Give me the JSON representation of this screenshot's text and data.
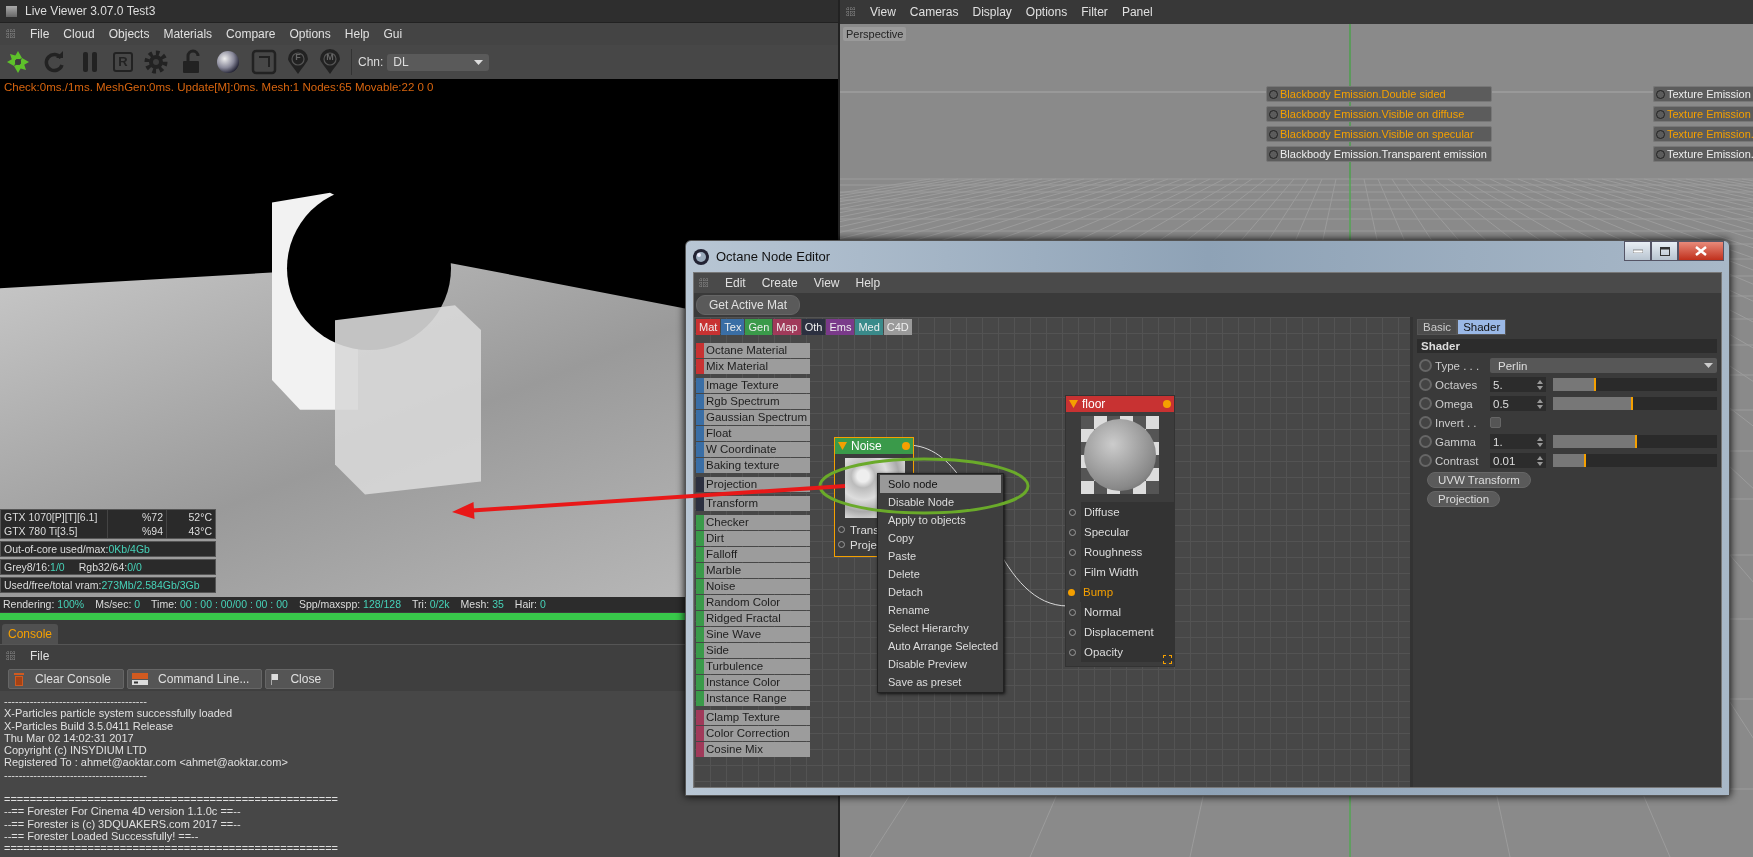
{
  "live_viewer": {
    "title": "Live Viewer 3.07.0 Test3",
    "menu": [
      "File",
      "Cloud",
      "Objects",
      "Materials",
      "Compare",
      "Options",
      "Help",
      "Gui"
    ],
    "toolbar": [
      {
        "kind": "logo"
      },
      {
        "kind": "refresh"
      },
      {
        "kind": "pause"
      },
      {
        "kind": "letter",
        "label": "R"
      },
      {
        "kind": "gear"
      },
      {
        "kind": "lock"
      },
      {
        "kind": "sphere"
      },
      {
        "kind": "frame"
      },
      {
        "kind": "pin",
        "label": "F"
      },
      {
        "kind": "pin",
        "label": "M"
      }
    ],
    "channel": {
      "label": "Chn:",
      "value": "DL"
    },
    "stats_line": "Check:0ms./1ms. MeshGen:0ms. Update[M]:0ms. Mesh:1 Nodes:65 Movable:22  0 0",
    "gpus": [
      {
        "name": "GTX 1070[P][T][6.1]",
        "load": "%72",
        "temp": "52°C"
      },
      {
        "name": "GTX 780 Ti[3.5]",
        "load": "%94",
        "temp": "43°C"
      }
    ],
    "memory": [
      [
        {
          "label": "Out-of-core used/max:",
          "value": "0Kb/4Gb"
        }
      ],
      [
        {
          "label": "Grey8/16:",
          "value": "1/0"
        },
        {
          "label": "Rgb32/64:",
          "value": "0/0"
        }
      ],
      [
        {
          "label": "Used/free/total vram:",
          "value": "273Mb/2.584Gb/3Gb"
        }
      ]
    ],
    "render_status": [
      {
        "label": "Rendering:",
        "value": "100%"
      },
      {
        "label": "Ms/sec:",
        "value": "0"
      },
      {
        "label": "Time:",
        "value": "00 : 00 : 00/00 : 00 : 00"
      },
      {
        "label": "Spp/maxspp:",
        "value": "128/128"
      },
      {
        "label": "Tri:",
        "value": "0/2k"
      },
      {
        "label": "Mesh:",
        "value": "35"
      },
      {
        "label": "Hair:",
        "value": "0"
      }
    ],
    "progress": {
      "level": 1
    }
  },
  "console": {
    "tab": "Console",
    "menu": [
      "File"
    ],
    "buttons": [
      {
        "kind": "trash",
        "label": "Clear Console"
      },
      {
        "kind": "terminal",
        "label": "Command Line..."
      },
      {
        "kind": "flag",
        "label": "Close"
      }
    ],
    "blocks": [
      [
        "---------------------------------------",
        "X-Particles particle system successfully loaded",
        "X-Particles Build 3.5.0411 Release",
        "Thu Mar 02 14:02:31 2017",
        "Copyright (c) INSYDIUM LTD",
        "Registered To : ahmet@aoktar.com <ahmet@aoktar.com>",
        "---------------------------------------"
      ],
      [
        "====================================================",
        "--== Forester For Cinema 4D version 1.1.0c ==--",
        "--== Forester is (c) 3DQUAKERS.com 2017 ==--",
        "--== Forester Loaded Successfully! ==--",
        "===================================================="
      ]
    ]
  },
  "viewport": {
    "menu": [
      "View",
      "Cameras",
      "Display",
      "Options",
      "Filter",
      "Panel"
    ],
    "view": "Perspective",
    "tag_columns": [
      [
        {
          "text": "Blackbody Emission.Double sided",
          "highlighted": true
        },
        {
          "text": "Blackbody Emission.Visible on diffuse",
          "highlighted": true
        },
        {
          "text": "Blackbody Emission.Visible on specular",
          "highlighted": true
        },
        {
          "text": "Blackbody Emission.Transparent emission",
          "highlighted": false
        }
      ],
      [
        {
          "text": "Texture Emission",
          "highlighted": false
        },
        {
          "text": "Texture Emission",
          "highlighted": true
        },
        {
          "text": "Texture Emission.",
          "highlighted": true
        },
        {
          "text": "Texture Emission.",
          "highlighted": false
        }
      ]
    ]
  },
  "node_editor": {
    "title": "Octane Node Editor",
    "menu": [
      "Edit",
      "Create",
      "View",
      "Help"
    ],
    "get_active": "Get Active Mat",
    "categories": [
      {
        "label": "Mat",
        "color": "#c83232"
      },
      {
        "label": "Tex",
        "color": "#3a6ea5"
      },
      {
        "label": "Gen",
        "color": "#3a9a4a"
      },
      {
        "label": "Map",
        "color": "#a03a5a"
      },
      {
        "label": "Oth",
        "color": "#2c3040"
      },
      {
        "label": "Ems",
        "color": "#7a3a8a"
      },
      {
        "label": "Med",
        "color": "#3a8a8a"
      },
      {
        "label": "C4D",
        "color": "#9a9a9a"
      }
    ],
    "palette": [
      {
        "color": "#c83232",
        "items": [
          "Octane Material",
          "Mix Material"
        ]
      },
      {
        "color": "#3a6ea5",
        "items": [
          "Image Texture",
          "Rgb Spectrum",
          "Gaussian Spectrum",
          "Float",
          "W Coordinate",
          "Baking texture"
        ]
      },
      {
        "color": "#2c3040",
        "items": [
          "Projection"
        ]
      },
      {
        "color": "#2c3040",
        "items": [
          "Transform"
        ]
      },
      {
        "color": "#3a9a4a",
        "items": [
          "Checker",
          "Dirt",
          "Falloff",
          "Marble",
          "Noise",
          "Random Color",
          "Ridged Fractal",
          "Sine Wave",
          "Side",
          "Turbulence",
          "Instance Color",
          "Instance Range"
        ]
      },
      {
        "color": "#a03a5a",
        "items": [
          "Clamp Texture",
          "Color Correction",
          "Cosine Mix"
        ]
      }
    ],
    "nodes": [
      {
        "title": "Noise",
        "color": "#3a9a4a",
        "selected": true,
        "ports": [
          {
            "label": "Trans",
            "connected": false
          },
          {
            "label": "Proje",
            "connected": false
          }
        ]
      },
      {
        "title": "floor",
        "color": "#c83232",
        "selected": false,
        "ports": [
          {
            "label": "Diffuse",
            "connected": false
          },
          {
            "label": "Specular",
            "connected": false
          },
          {
            "label": "Roughness",
            "connected": false
          },
          {
            "label": "Film Width",
            "connected": false
          },
          {
            "label": "Bump",
            "connected": true
          },
          {
            "label": "Normal",
            "connected": false
          },
          {
            "label": "Displacement",
            "connected": false
          },
          {
            "label": "Opacity",
            "connected": false
          }
        ]
      }
    ],
    "context_menu": [
      {
        "label": "Solo node",
        "selected": true
      },
      {
        "label": "Disable Node",
        "selected": false
      },
      {
        "label": "Apply to objects",
        "selected": false
      },
      {
        "label": "Copy",
        "selected": false
      },
      {
        "label": "Paste",
        "selected": false
      },
      {
        "label": "Delete",
        "selected": false
      },
      {
        "label": "Detach",
        "selected": false
      },
      {
        "label": "Rename",
        "selected": false
      },
      {
        "label": "Select Hierarchy",
        "selected": false
      },
      {
        "label": "Auto Arrange Selected",
        "selected": false
      },
      {
        "label": "Disable Preview",
        "selected": false
      },
      {
        "label": "Save as preset",
        "selected": false
      }
    ],
    "panel": {
      "tabs": [
        {
          "label": "Basic",
          "selected": false
        },
        {
          "label": "Shader",
          "selected": true
        }
      ],
      "section": "Shader",
      "params": [
        {
          "kind": "dropdown",
          "label": "Type . . .",
          "value": "Perlin"
        },
        {
          "kind": "slider",
          "label": "Octaves",
          "value": "5.",
          "level": 0.26
        },
        {
          "kind": "slider",
          "label": "Omega",
          "value": "0.5",
          "level": 0.49
        },
        {
          "kind": "checkbox",
          "label": "Invert . .",
          "checked": false
        },
        {
          "kind": "slider",
          "label": "Gamma",
          "value": "1.",
          "level": 0.51
        },
        {
          "kind": "slider",
          "label": "Contrast",
          "value": "0.01",
          "level": 0.2
        }
      ],
      "buttons": [
        "UVW Transform",
        "Projection"
      ]
    }
  }
}
